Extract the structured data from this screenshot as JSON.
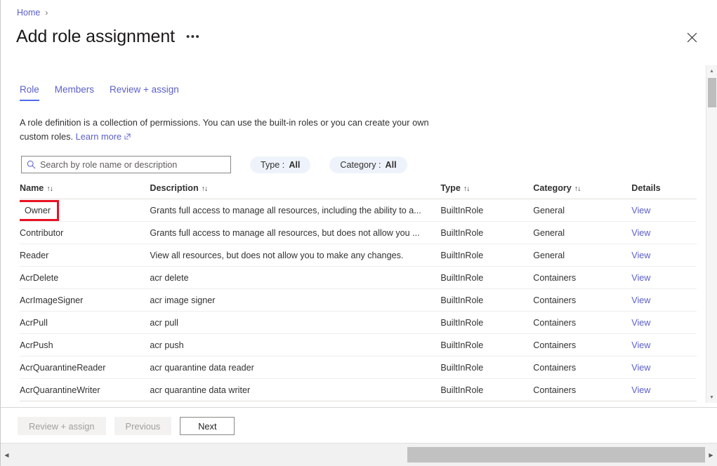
{
  "breadcrumb": {
    "home": "Home",
    "separator": "›"
  },
  "header": {
    "title": "Add role assignment",
    "more_label": "•••",
    "close_label": "✕"
  },
  "tabs": [
    {
      "label": "Role",
      "active": true
    },
    {
      "label": "Members",
      "active": false
    },
    {
      "label": "Review + assign",
      "active": false
    }
  ],
  "description": {
    "text": "A role definition is a collection of permissions. You can use the built-in roles or you can create your own custom roles.",
    "link": "Learn more",
    "external_glyph": "↗"
  },
  "search": {
    "placeholder": "Search by role name or description",
    "value": ""
  },
  "filters": [
    {
      "label": "Type :",
      "value": "All"
    },
    {
      "label": "Category :",
      "value": "All"
    }
  ],
  "table": {
    "columns": [
      {
        "label": "Name",
        "sortable": true
      },
      {
        "label": "Description",
        "sortable": true
      },
      {
        "label": "Type",
        "sortable": true
      },
      {
        "label": "Category",
        "sortable": true
      },
      {
        "label": "Details",
        "sortable": false
      }
    ],
    "sort_glyph": "↑↓",
    "details_link_label": "View",
    "rows": [
      {
        "name": "Owner",
        "description": "Grants full access to manage all resources, including the ability to a...",
        "type": "BuiltInRole",
        "category": "General",
        "details": "View",
        "highlighted": true
      },
      {
        "name": "Contributor",
        "description": "Grants full access to manage all resources, but does not allow you ...",
        "type": "BuiltInRole",
        "category": "General",
        "details": "View",
        "highlighted": false
      },
      {
        "name": "Reader",
        "description": "View all resources, but does not allow you to make any changes.",
        "type": "BuiltInRole",
        "category": "General",
        "details": "View",
        "highlighted": false
      },
      {
        "name": "AcrDelete",
        "description": "acr delete",
        "type": "BuiltInRole",
        "category": "Containers",
        "details": "View",
        "highlighted": false
      },
      {
        "name": "AcrImageSigner",
        "description": "acr image signer",
        "type": "BuiltInRole",
        "category": "Containers",
        "details": "View",
        "highlighted": false
      },
      {
        "name": "AcrPull",
        "description": "acr pull",
        "type": "BuiltInRole",
        "category": "Containers",
        "details": "View",
        "highlighted": false
      },
      {
        "name": "AcrPush",
        "description": "acr push",
        "type": "BuiltInRole",
        "category": "Containers",
        "details": "View",
        "highlighted": false
      },
      {
        "name": "AcrQuarantineReader",
        "description": "acr quarantine data reader",
        "type": "BuiltInRole",
        "category": "Containers",
        "details": "View",
        "highlighted": false
      },
      {
        "name": "AcrQuarantineWriter",
        "description": "acr quarantine data writer",
        "type": "BuiltInRole",
        "category": "Containers",
        "details": "View",
        "highlighted": false
      }
    ]
  },
  "footer": {
    "review_assign": "Review + assign",
    "previous": "Previous",
    "next": "Next"
  },
  "scrollbars": {
    "up_glyph": "▲",
    "down_glyph": "▼",
    "left_glyph": "◀",
    "right_glyph": "▶"
  },
  "colors": {
    "link": "#5b5fc7",
    "accent": "#4f6bed",
    "highlight": "#e81123",
    "pill_bg": "#eef3fb"
  }
}
